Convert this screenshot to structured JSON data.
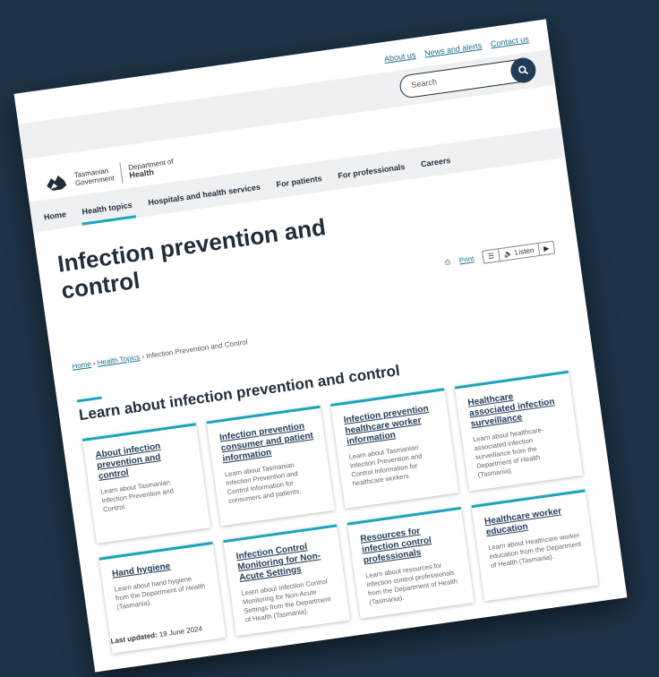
{
  "utility_links": [
    "About us",
    "News and alerts",
    "Contact us"
  ],
  "search": {
    "placeholder": "Search"
  },
  "logo": {
    "gov_line1": "Tasmanian",
    "gov_line2": "Government",
    "dept_line1": "Department of",
    "dept_line2": "Health"
  },
  "nav": [
    "Home",
    "Health topics",
    "Hospitals and health services",
    "For patients",
    "For professionals",
    "Careers"
  ],
  "page_title": "Infection prevention and control",
  "tools": {
    "print": "Print",
    "listen": "Listen"
  },
  "breadcrumb": [
    "Home",
    "Health Topics",
    "Infection Prevention and Control"
  ],
  "section_title": "Learn about infection prevention and control",
  "cards": [
    {
      "title": "About infection prevention and control",
      "desc": "Learn about Tasmanian Infection Prevention and Control."
    },
    {
      "title": "Infection prevention consumer and patient information",
      "desc": "Learn about Tasmanian Infection Prevention and Control Information for consumers and patients."
    },
    {
      "title": "Infection prevention healthcare worker information",
      "desc": "Learn about Tasmanian Infection Prevention and Control Information for healthcare workers."
    },
    {
      "title": "Healthcare associated infection surveillance",
      "desc": "Learn about healthcare-associated infection surveillance from the Department of Health (Tasmania)."
    },
    {
      "title": "Hand hygiene",
      "desc": "Learn about hand hygiene from the Department of Health (Tasmania)."
    },
    {
      "title": "Infection Control Monitoring for Non-Acute Settings",
      "desc": "Learn about Infection Control Monitoring for Non-Acute Settings from the Department of Health (Tasmania)."
    },
    {
      "title": "Resources for infection control professionals",
      "desc": "Learn about resources for infection control professionals from the Department of Health (Tasmania)."
    },
    {
      "title": "Healthcare worker education",
      "desc": "Learn about Healthcare worker education from the Department of Health (Tasmania)."
    }
  ],
  "last_updated": {
    "label": "Last updated:",
    "value": "19 June 2024"
  },
  "colors": {
    "accent": "#1aa5b8",
    "navy": "#1f3b57",
    "background": "#1e3347"
  }
}
